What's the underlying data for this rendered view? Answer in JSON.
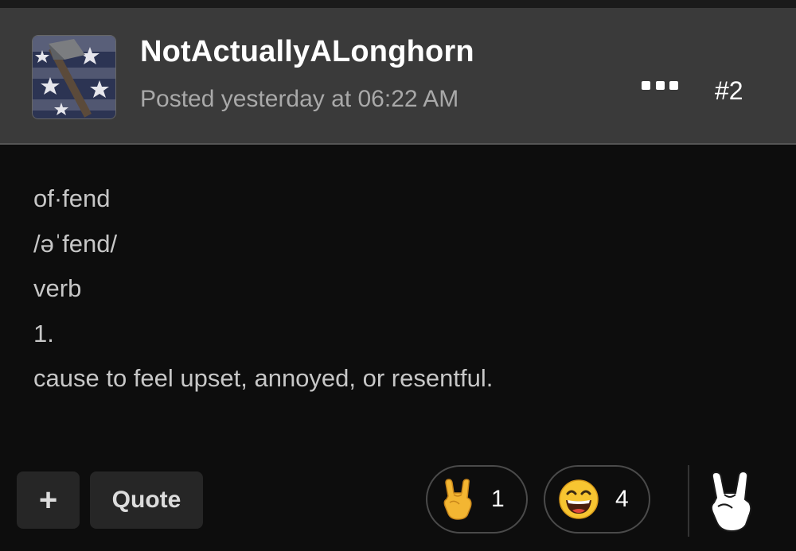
{
  "post": {
    "username": "NotActuallyALonghorn",
    "posted": "Posted yesterday at 06:22 AM",
    "post_number": "#2",
    "body": [
      "of·fend",
      "/əˈfend/",
      "verb",
      "1.",
      "cause to feel upset, annoyed, or resentful."
    ]
  },
  "actions": {
    "plus_label": "+",
    "quote_label": "Quote"
  },
  "reactions": [
    {
      "icon": "rock-on-hand-icon",
      "count": "1"
    },
    {
      "icon": "laughing-face-icon",
      "count": "4"
    }
  ],
  "react_icon": "rock-on-hand-icon",
  "colors": {
    "header_bg": "#3a3a3a",
    "body_bg": "#0d0d0d",
    "button_bg": "#262626"
  }
}
